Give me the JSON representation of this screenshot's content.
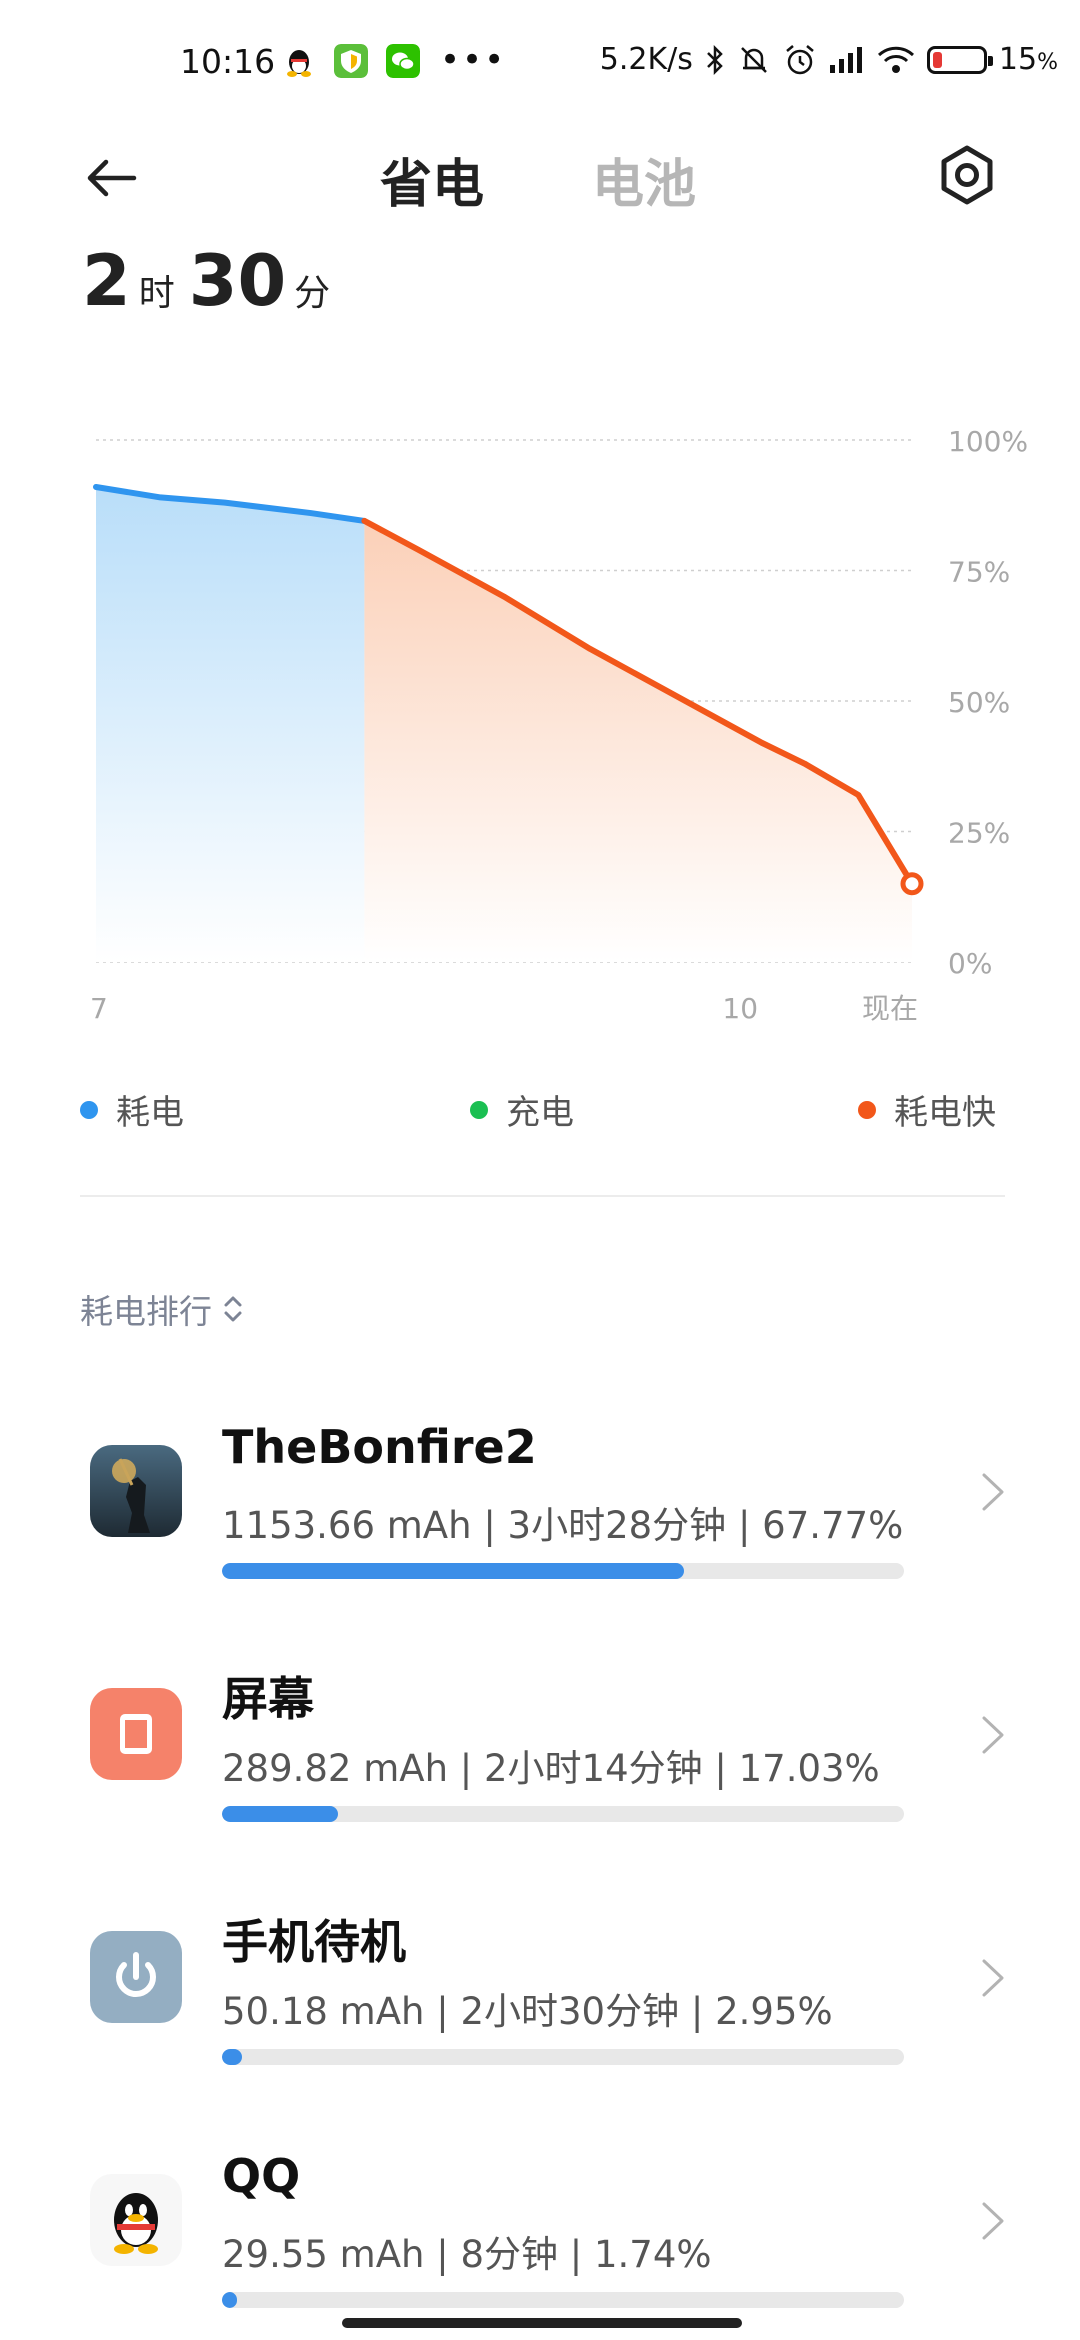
{
  "status_bar": {
    "time": "10:16",
    "network_speed": "5.2K/s",
    "battery": "15",
    "battery_unit": "%",
    "icons": [
      "qq-icon",
      "shield-icon",
      "wechat-icon",
      "more-dots-icon",
      "bluetooth-icon",
      "mute-icon",
      "alarm-icon",
      "signal-icon",
      "wifi-icon",
      "battery-icon"
    ],
    "dots": "•••"
  },
  "header": {
    "tab_active": "省电",
    "tab_inactive": "电池"
  },
  "estimate": {
    "hours": "2",
    "hours_unit": "时",
    "minutes": "30",
    "minutes_unit": "分"
  },
  "chart_data": {
    "type": "area",
    "y_ticks": [
      "100%",
      "75%",
      "50%",
      "25%",
      "0%"
    ],
    "x_ticks": [
      "7",
      "10",
      "现在"
    ],
    "ylim": [
      0,
      100
    ],
    "grid": true,
    "segments": [
      {
        "name": "耗电",
        "color": "#2f95ef",
        "x": [
          7.0,
          7.3,
          7.6,
          8.0,
          8.25
        ],
        "y": [
          91,
          89,
          88,
          86,
          84.5
        ]
      },
      {
        "name": "耗电快",
        "color": "#f2571a",
        "x": [
          8.25,
          8.5,
          8.9,
          9.3,
          9.7,
          10.1,
          10.3,
          10.55,
          10.8
        ],
        "y": [
          84.5,
          79,
          70,
          60,
          51,
          42,
          38,
          32,
          15
        ]
      }
    ],
    "end_marker": {
      "x": 10.8,
      "y": 15
    }
  },
  "legend": [
    {
      "label": "耗电",
      "color": "#2f95ef"
    },
    {
      "label": "充电",
      "color": "#1bbf52"
    },
    {
      "label": "耗电快",
      "color": "#f2571a"
    }
  ],
  "ranking": {
    "label": "耗电排行",
    "items": [
      {
        "name": "TheBonfire2",
        "detail": "1153.66 mAh | 3小时28分钟 | 67.77%",
        "percent": 67.77,
        "icon": "game-icon"
      },
      {
        "name": "屏幕",
        "detail": "289.82 mAh | 2小时14分钟 | 17.03%",
        "percent": 17.03,
        "icon": "screen-icon"
      },
      {
        "name": "手机待机",
        "detail": "50.18 mAh | 2小时30分钟 | 2.95%",
        "percent": 2.95,
        "icon": "power-icon"
      },
      {
        "name": "QQ",
        "detail": "29.55 mAh | 8分钟 | 1.74%",
        "percent": 1.74,
        "icon": "qq-icon"
      }
    ]
  }
}
